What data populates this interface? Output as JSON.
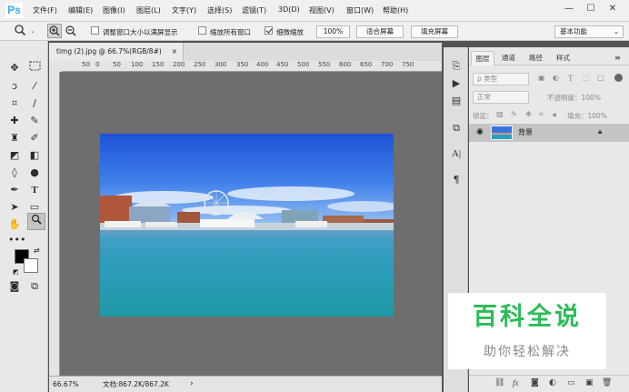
{
  "app": {
    "logo": "Ps"
  },
  "menubar": {
    "items": [
      "文件(F)",
      "编辑(E)",
      "图像(I)",
      "图层(L)",
      "文字(Y)",
      "选择(S)",
      "滤镜(T)",
      "3D(D)",
      "视图(V)",
      "窗口(W)",
      "帮助(H)"
    ],
    "window_buttons": [
      "—",
      "☐",
      "✕"
    ]
  },
  "options": {
    "resize_label": "调整窗口大小以满屏显示",
    "zoom_all_label": "缩放所有窗口",
    "scrubby_label": "细微缩放",
    "zoom_value": "100%",
    "fit_screen": "适合屏幕",
    "fill_screen": "填充屏幕",
    "workspace": "基本功能",
    "resize_checked": false,
    "zoom_all_checked": false,
    "scrubby_checked": true
  },
  "document": {
    "tab_title": "timg (2).jpg @ 66.7%(RGB/8#)",
    "tab_close": "×",
    "ruler_ticks": [
      "50",
      "0",
      "50",
      "100",
      "150",
      "200",
      "250",
      "300",
      "350",
      "400",
      "450",
      "500",
      "550",
      "600",
      "650",
      "700",
      "750"
    ],
    "zoom_status": "66.67%",
    "doc_size": "文档:867.2K/867.2K"
  },
  "layers": {
    "tabs": [
      "图层",
      "通道",
      "路径",
      "样式"
    ],
    "filter_kind": "ρ 类型",
    "blend_mode": "正常",
    "opacity_label": "不透明度：100%",
    "lock_label": "锁定：",
    "fill_label": "填充：100%",
    "layer_name": "背景"
  },
  "watermark": {
    "title": "百科全说",
    "subtitle": "助你轻松解决"
  }
}
